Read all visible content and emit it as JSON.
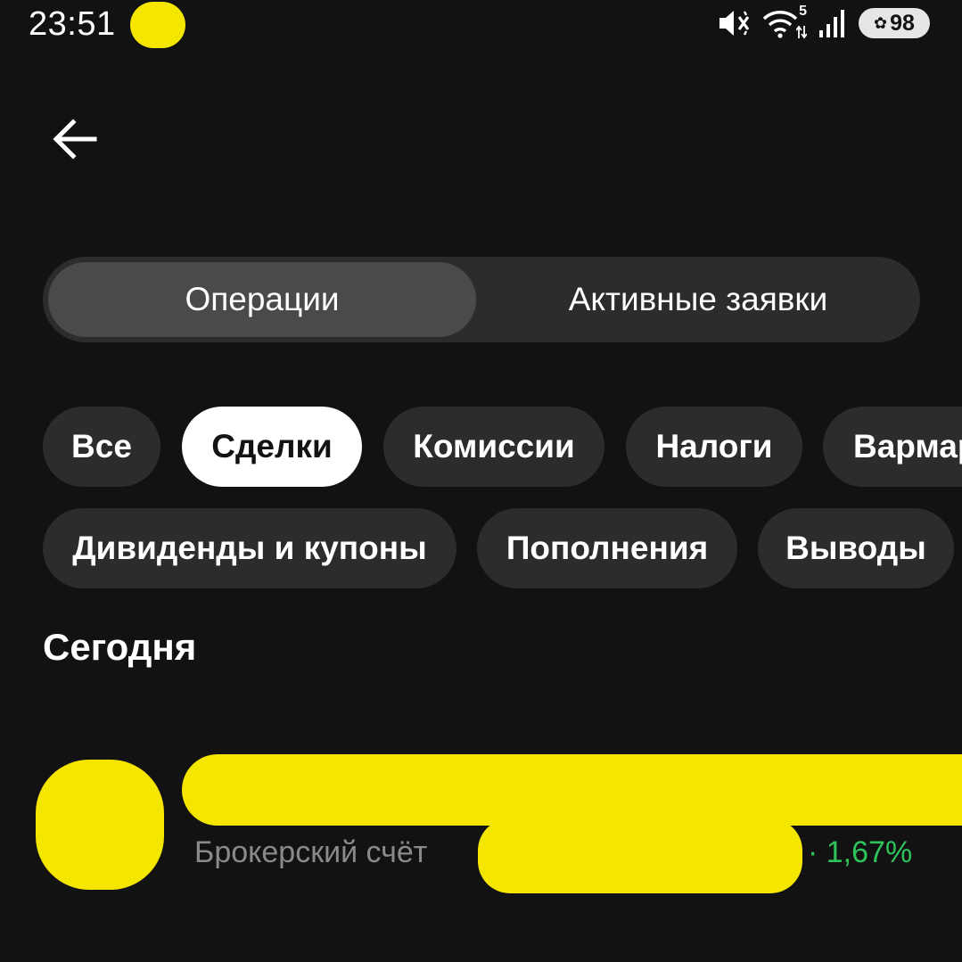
{
  "status_bar": {
    "time": "23:51",
    "icons": [
      "mute-icon",
      "wifi-icon",
      "signal-icon"
    ],
    "network_badge": "5",
    "battery_level": "98"
  },
  "header": {
    "back_icon": "arrow-left-icon"
  },
  "tabs": [
    {
      "label": "Операции",
      "active": true
    },
    {
      "label": "Активные заявки",
      "active": false
    }
  ],
  "filters": {
    "row1": [
      {
        "label": "Все",
        "selected": false
      },
      {
        "label": "Сделки",
        "selected": true
      },
      {
        "label": "Комиссии",
        "selected": false
      },
      {
        "label": "Налоги",
        "selected": false
      },
      {
        "label": "Вармаржа",
        "selected": false
      }
    ],
    "row2": [
      {
        "label": "Дивиденды и купоны",
        "selected": false
      },
      {
        "label": "Пополнения",
        "selected": false
      },
      {
        "label": "Выводы",
        "selected": false
      }
    ]
  },
  "section": {
    "title": "Сегодня"
  },
  "operation": {
    "subtitle": "Брокерский счёт",
    "percent": "· 1,67%"
  },
  "colors": {
    "background": "#121212",
    "chip": "#2c2c2c",
    "chip_selected": "#ffffff",
    "positive": "#2ec45a",
    "redaction": "#f5e600"
  }
}
